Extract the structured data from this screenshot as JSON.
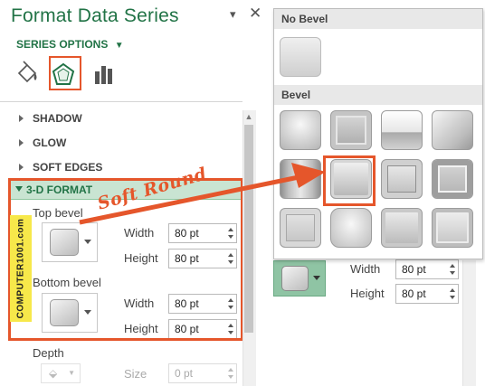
{
  "pane": {
    "title": "Format Data Series",
    "series_options_label": "SERIES OPTIONS",
    "tabs": [
      {
        "name": "fill-line",
        "icon": "paint-bucket-icon"
      },
      {
        "name": "effects",
        "icon": "pentagon-icon",
        "selected": true
      },
      {
        "name": "series-options",
        "icon": "bar-chart-icon"
      }
    ],
    "sections": {
      "shadow": "SHADOW",
      "glow": "GLOW",
      "soft_edges": "SOFT EDGES",
      "format_3d": "3-D FORMAT"
    },
    "top_bevel": {
      "label": "Top bevel",
      "width_label": "Width",
      "width_value": "80 pt",
      "height_label": "Height",
      "height_value": "80 pt"
    },
    "bottom_bevel": {
      "label": "Bottom bevel",
      "width_label": "Width",
      "width_value": "80 pt",
      "height_label": "Height",
      "height_value": "80 pt"
    },
    "depth": {
      "label": "Depth",
      "size_label": "Size",
      "size_value": "0 pt"
    }
  },
  "gallery": {
    "no_bevel_header": "No Bevel",
    "bevel_header": "Bevel",
    "selected_index": 5,
    "tiles": [
      "circle",
      "relaxed-inset",
      "cross",
      "cool-slant",
      "angle",
      "soft-round",
      "convex",
      "slope",
      "divot",
      "riblet",
      "hard-edge",
      "art-deco"
    ]
  },
  "right_pane": {
    "width_label": "Width",
    "width_value": "80 pt",
    "height_label": "Height",
    "height_value": "80 pt"
  },
  "annotation": {
    "text": "Soft Round",
    "color": "#e5562b"
  },
  "watermark": {
    "text": "COMPUTER1001.com"
  },
  "colors": {
    "accent_green": "#217346",
    "highlight": "#e5562b",
    "section_bar": "#c9e4d2"
  }
}
